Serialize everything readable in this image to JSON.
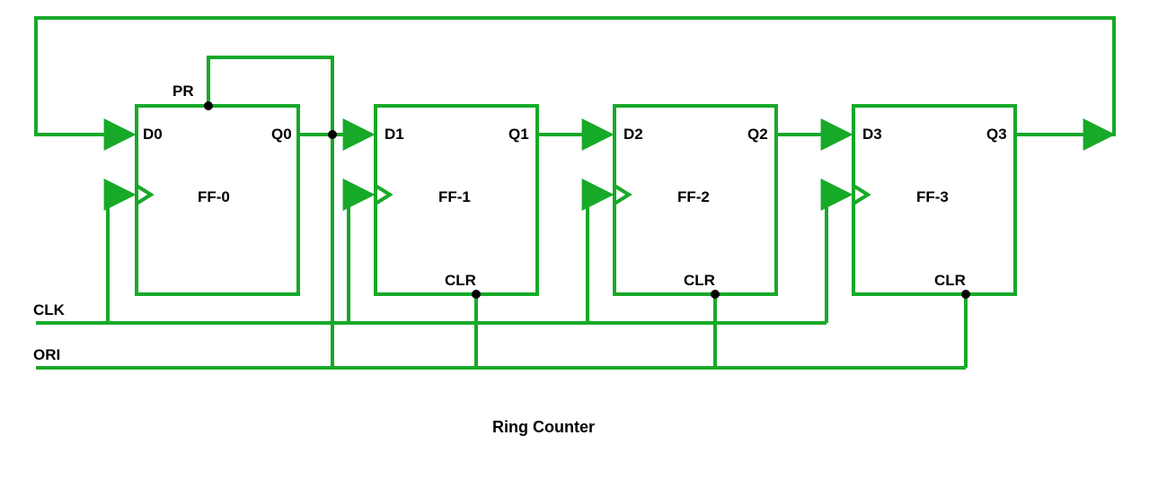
{
  "title": "Ring Counter",
  "signals": {
    "clk": "CLK",
    "ori": "ORI"
  },
  "ff": [
    {
      "name": "FF-0",
      "d": "D0",
      "q": "Q0",
      "pr": "PR",
      "clr": ""
    },
    {
      "name": "FF-1",
      "d": "D1",
      "q": "Q1",
      "pr": "",
      "clr": "CLR"
    },
    {
      "name": "FF-2",
      "d": "D2",
      "q": "Q2",
      "pr": "",
      "clr": "CLR"
    },
    {
      "name": "FF-3",
      "d": "D3",
      "q": "Q3",
      "pr": "",
      "clr": "CLR"
    }
  ]
}
